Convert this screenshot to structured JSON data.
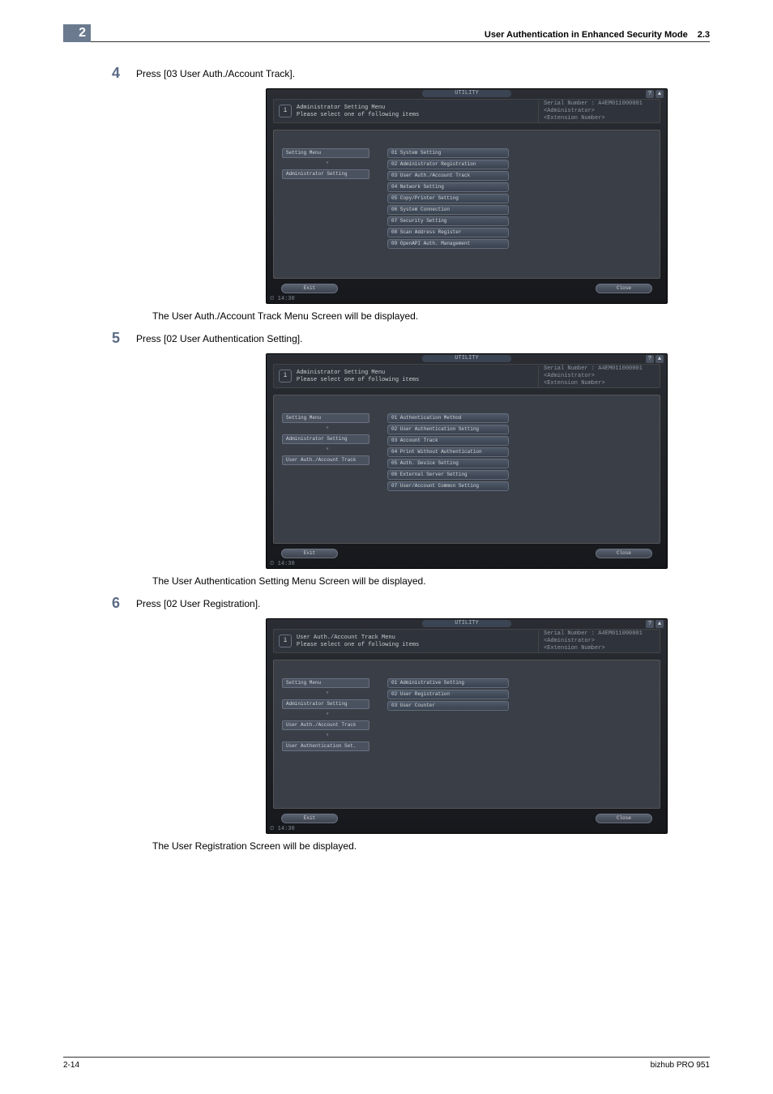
{
  "page": {
    "chapter_tab": "2",
    "header_title": "User Authentication in Enhanced Security Mode",
    "header_section": "2.3",
    "footer_left": "2-14",
    "footer_right": "bizhub PRO 951"
  },
  "steps": {
    "s4": {
      "num": "4",
      "text": "Press [03 User Auth./Account Track]."
    },
    "s4_caption": "The User Auth./Account Track Menu Screen will be displayed.",
    "s5": {
      "num": "5",
      "text": "Press [02 User Authentication Setting]."
    },
    "s5_caption": "The User Authentication Setting Menu Screen will be displayed.",
    "s6": {
      "num": "6",
      "text": "Press [02 User Registration]."
    },
    "s6_caption": "The User Registration Screen will be displayed."
  },
  "shot_common": {
    "utility": "UTILITY",
    "serial_label": "Serial Number",
    "serial_value": "A4EM011000001",
    "admin": "<Administrator>",
    "ext": "<Extension Number>",
    "exit": "Exit",
    "close": "Close",
    "time": "14:30"
  },
  "shot1": {
    "title1": "Administrator Setting Menu",
    "title2": "Please select one of following items",
    "crumbs": [
      "Setting Menu",
      "Administrator Setting"
    ],
    "menu": [
      "01 System Setting",
      "02 Administrator Registration",
      "03 User Auth./Account Track",
      "04 Network Setting",
      "05 Copy/Printer Setting",
      "06 System Connection",
      "07 Security Setting",
      "08 Scan Address Register",
      "09 OpenAPI Auth. Management"
    ]
  },
  "shot2": {
    "title1": "Administrator Setting Menu",
    "title2": "Please select one of following items",
    "crumbs": [
      "Setting Menu",
      "Administrator Setting",
      "User Auth./Account Track"
    ],
    "menu": [
      "01 Authentication Method",
      "02 User Authentication Setting",
      "03 Account Track",
      "04 Print Without Authentication",
      "05 Auth. Device Setting",
      "06 External Server Setting",
      "07 User/Account Common Setting"
    ]
  },
  "shot3": {
    "title1": "User Auth./Account Track Menu",
    "title2": "Please select one of following items",
    "crumbs": [
      "Setting Menu",
      "Administrator Setting",
      "User Auth./Account Track",
      "User Authentication Set."
    ],
    "menu": [
      "01 Administrative Setting",
      "02 User Registration",
      "03 User Counter"
    ]
  }
}
